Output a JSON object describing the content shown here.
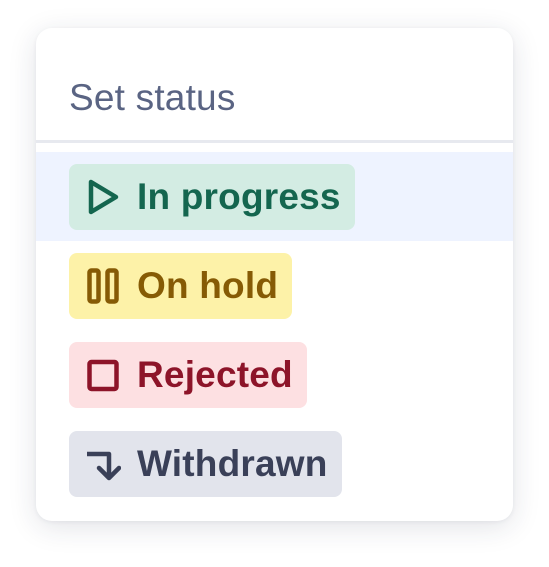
{
  "menu": {
    "title": "Set status",
    "options": [
      {
        "label": "In progress",
        "icon": "play-icon",
        "bg": "#d3ece3",
        "fg": "#14664f",
        "highlighted": true
      },
      {
        "label": "On hold",
        "icon": "pause-icon",
        "bg": "#fdf2a8",
        "fg": "#865b05",
        "highlighted": false
      },
      {
        "label": "Rejected",
        "icon": "stop-icon",
        "bg": "#fde0e2",
        "fg": "#8d1429",
        "highlighted": false
      },
      {
        "label": "Withdrawn",
        "icon": "arrow-turn-down-icon",
        "bg": "#e2e4ec",
        "fg": "#3a4058",
        "highlighted": false
      }
    ]
  },
  "colors": {
    "highlight_bg": "#eef3ff",
    "title": "#5a6483",
    "divider": "#e7e9ef"
  }
}
